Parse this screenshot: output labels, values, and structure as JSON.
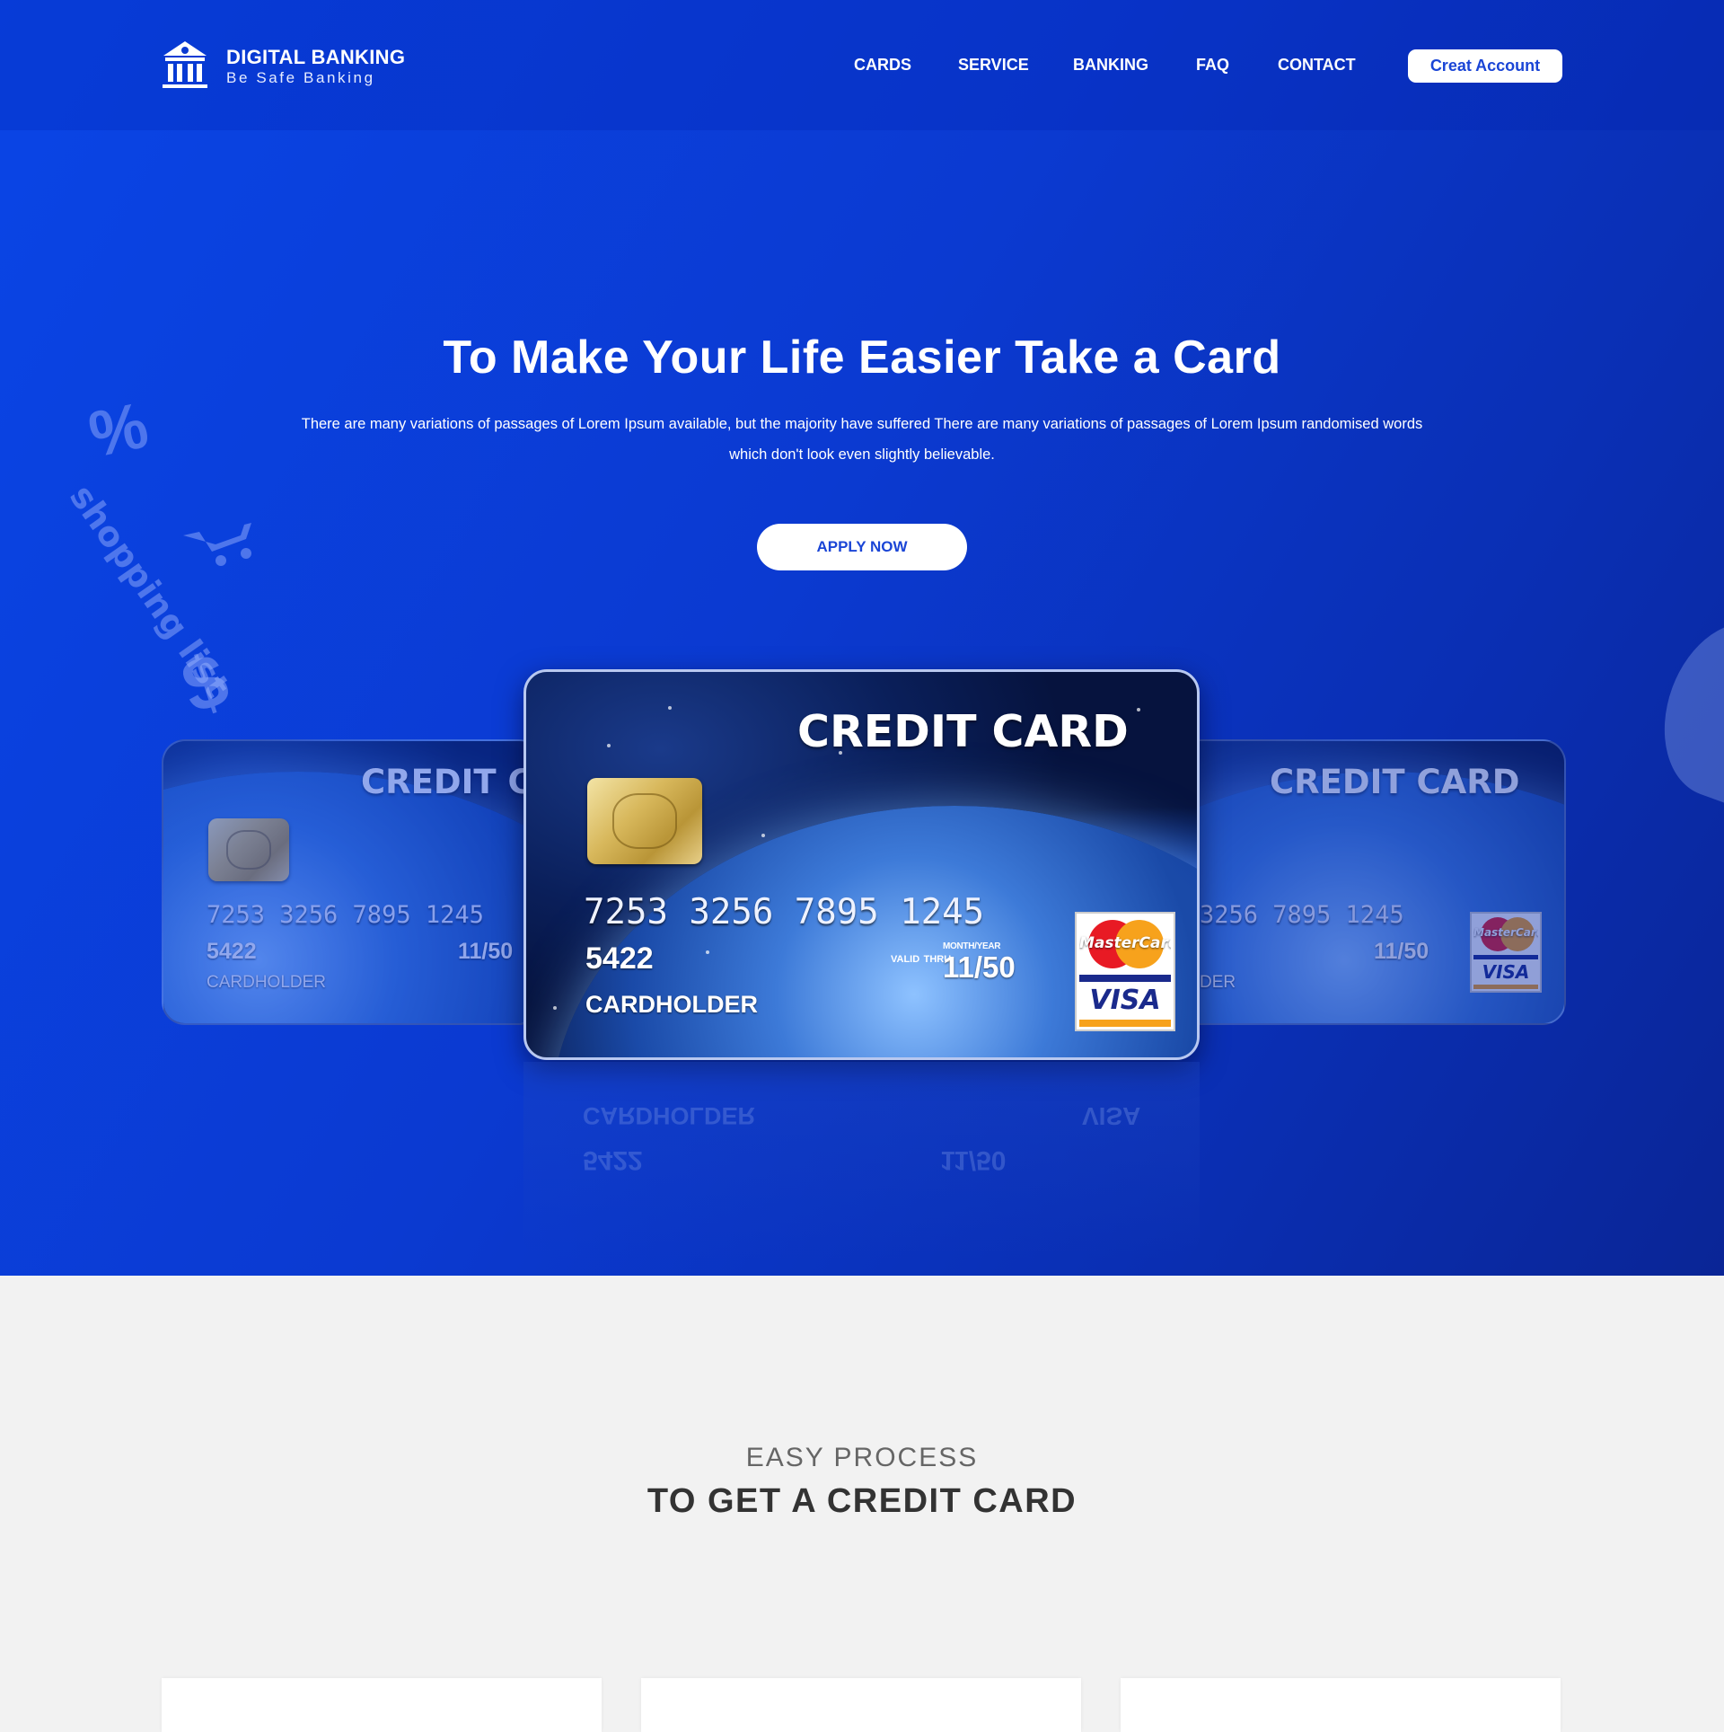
{
  "brand": {
    "title": "DIGITAL BANKING",
    "tagline": "Be Safe Banking",
    "logo_icon": "bank-building-icon"
  },
  "nav": {
    "items": [
      {
        "label": "CARDS"
      },
      {
        "label": "SERVICE"
      },
      {
        "label": "BANKING"
      },
      {
        "label": "FAQ"
      },
      {
        "label": "CONTACT"
      }
    ],
    "cta_label": "Creat Account"
  },
  "hero": {
    "title": "To Make Your Life Easier Take a Card",
    "description": "There are many variations of passages of Lorem Ipsum available, but the majority have suffered There are many variations of passages of Lorem Ipsum randomised words which don't look even slightly believable.",
    "apply_label": "APPLY NOW",
    "decorations": {
      "percent": "%",
      "dollar": "$",
      "shopping": "shopping list",
      "cart_icon": "shopping-cart-icon"
    }
  },
  "card": {
    "title": "CREDIT CARD",
    "title_partial": "CREDIT C",
    "number_groups": [
      "7253",
      "3256",
      "7895",
      "1245"
    ],
    "number_partial": "3256  7895  1245",
    "number_full": "7253  3256  7895  1245",
    "short_number": "5422",
    "valid_label_1": "VALID",
    "valid_label_2": "THRU",
    "month_year_label": "MONTH/YEAR",
    "expiry": "11/50",
    "holder": "CARDHOLDER",
    "holder_partial": "DER",
    "mastercard_label": "MasterCard",
    "visa_label": "VISA"
  },
  "process": {
    "label": "EASY PROCESS",
    "title": "TO GET A CREDIT CARD"
  },
  "colors": {
    "primary": "#0b3ad1",
    "accent_text": "#1a45d6",
    "section_bg": "#f2f2f2",
    "heading_dark": "#333333"
  }
}
